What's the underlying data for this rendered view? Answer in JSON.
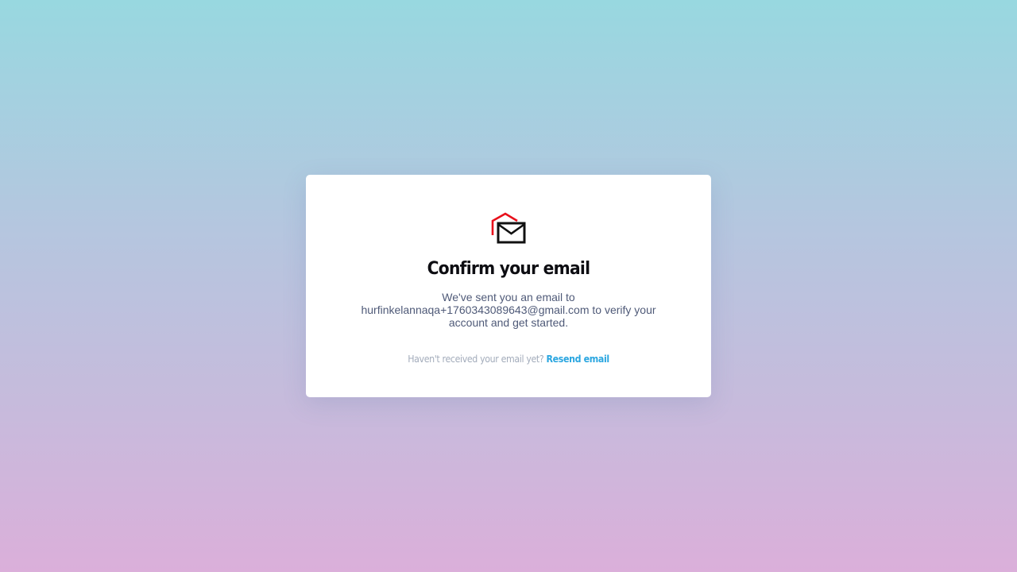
{
  "card": {
    "title": "Confirm your email",
    "message_prefix": "We've sent you an email to",
    "email": "hurfinkelannaqa+1760343089643@gmail.com",
    "message_suffix": "to verify your account and get started.",
    "resend_prompt": "Haven't received your email yet?",
    "resend_link": "Resend email"
  },
  "icons": {
    "logo": "mail-house-logo-icon"
  },
  "colors": {
    "logo_roof": "#e8101b",
    "logo_envelope": "#111111",
    "title": "#0d0d12",
    "message": "#4f5a78",
    "resend_prompt": "#a3acbb",
    "resend_link": "#2aa6e0"
  }
}
